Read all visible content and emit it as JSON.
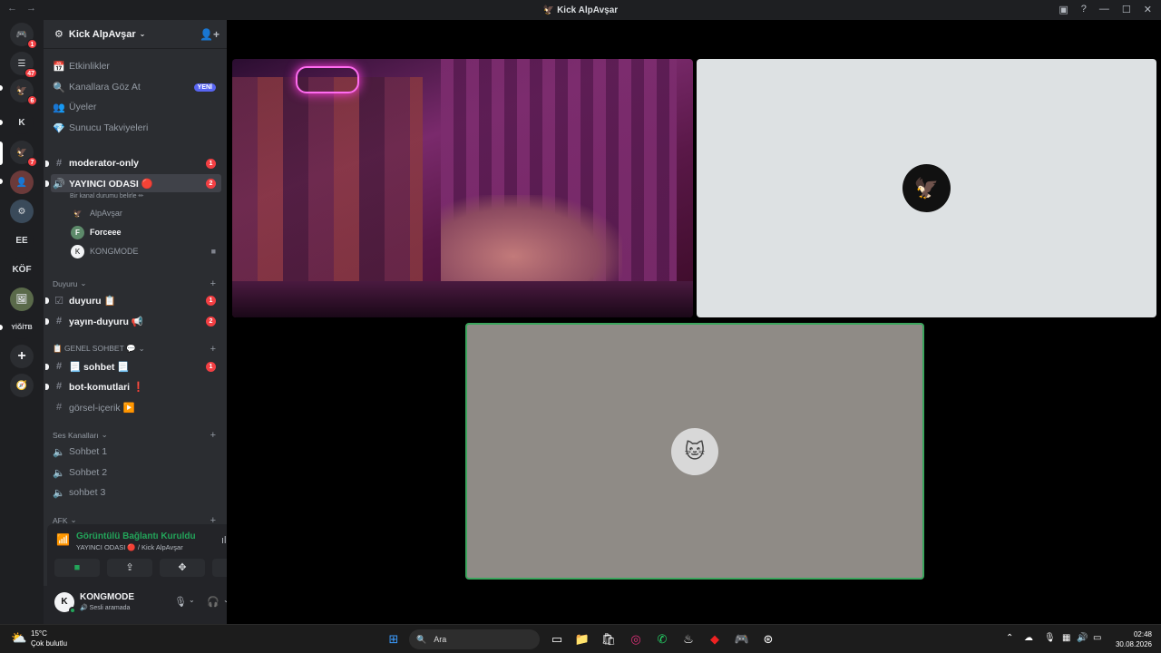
{
  "titlebar": {
    "title": "Kick AlpAvşar",
    "back": "←",
    "forward": "→"
  },
  "rail": {
    "servers": [
      {
        "label": "🎮",
        "badge": "1"
      },
      {
        "label": "☰",
        "badge": "47"
      },
      {
        "label": "🦅",
        "badge": "6"
      },
      {
        "label": "K",
        "badge": ""
      },
      {
        "label": "🦅",
        "badge": "7"
      },
      {
        "label": "👤",
        "badge": ""
      },
      {
        "label": "⚙",
        "badge": ""
      },
      {
        "label": "EE",
        "badge": ""
      },
      {
        "label": "KÖF",
        "badge": ""
      },
      {
        "label": "🖼",
        "badge": ""
      },
      {
        "label": "YİĞİTB",
        "badge": ""
      },
      {
        "label": "+",
        "badge": ""
      },
      {
        "label": "🧭",
        "badge": ""
      }
    ]
  },
  "sidebar": {
    "server_name": "Kick AlpAvşar",
    "top_items": [
      {
        "label": "Etkinlikler",
        "icon": "📅"
      },
      {
        "label": "Kanallara Göz At",
        "icon": "🔍",
        "tag": "YENİ"
      },
      {
        "label": "Üyeler",
        "icon": "👥"
      },
      {
        "label": "Sunucu Takviyeleri",
        "icon": "💎"
      }
    ],
    "channels": {
      "moderator": {
        "label": "moderator-only",
        "count": "1"
      },
      "voice_room": {
        "label": "YAYINCI ODASI 🔴",
        "count": "2",
        "sub": "Bir kanal durumu belirle ✏"
      },
      "voice_users": [
        {
          "name": "AlpAvşar",
          "avatar": "🦅"
        },
        {
          "name": "Forceee",
          "avatar": "F"
        },
        {
          "name": "KONGMODE",
          "avatar": "K"
        }
      ],
      "cat_duyuru": "Duyuru",
      "duyuru": {
        "label": "duyuru 📋",
        "count": "1"
      },
      "yayin_duyuru": {
        "label": "yayın-duyuru 📢",
        "count": "2"
      },
      "cat_genel": "📋 GENEL SOHBET 💬",
      "sohbet": {
        "label": "📃 sohbet 📃",
        "count": "1"
      },
      "bot": {
        "label": "bot-komutlari ❗"
      },
      "gorsel": {
        "label": "görsel-içerik ▶️"
      },
      "cat_ses": "Ses Kanalları",
      "ses": [
        "Sohbet 1",
        "Sohbet 2",
        "sohbet 3"
      ],
      "cat_afk": "AFK"
    }
  },
  "voice_panel": {
    "title": "Görüntülü Bağlantı Kuruldu",
    "subtitle": "YAYINCI ODASI 🔴 / Kick AlpAvşar"
  },
  "user": {
    "name": "KONGMODE",
    "status": "Sesli aramada",
    "initial": "K"
  },
  "taskbar": {
    "temp": "15°C",
    "condition": "Çok bulutlu",
    "search_placeholder": "Ara",
    "time": "02:48",
    "date": "30.08.2026"
  },
  "colors": {
    "accent": "#5865f2",
    "online": "#23a55a",
    "badge": "#f23f43",
    "speaking_border": "#3ba55d"
  }
}
